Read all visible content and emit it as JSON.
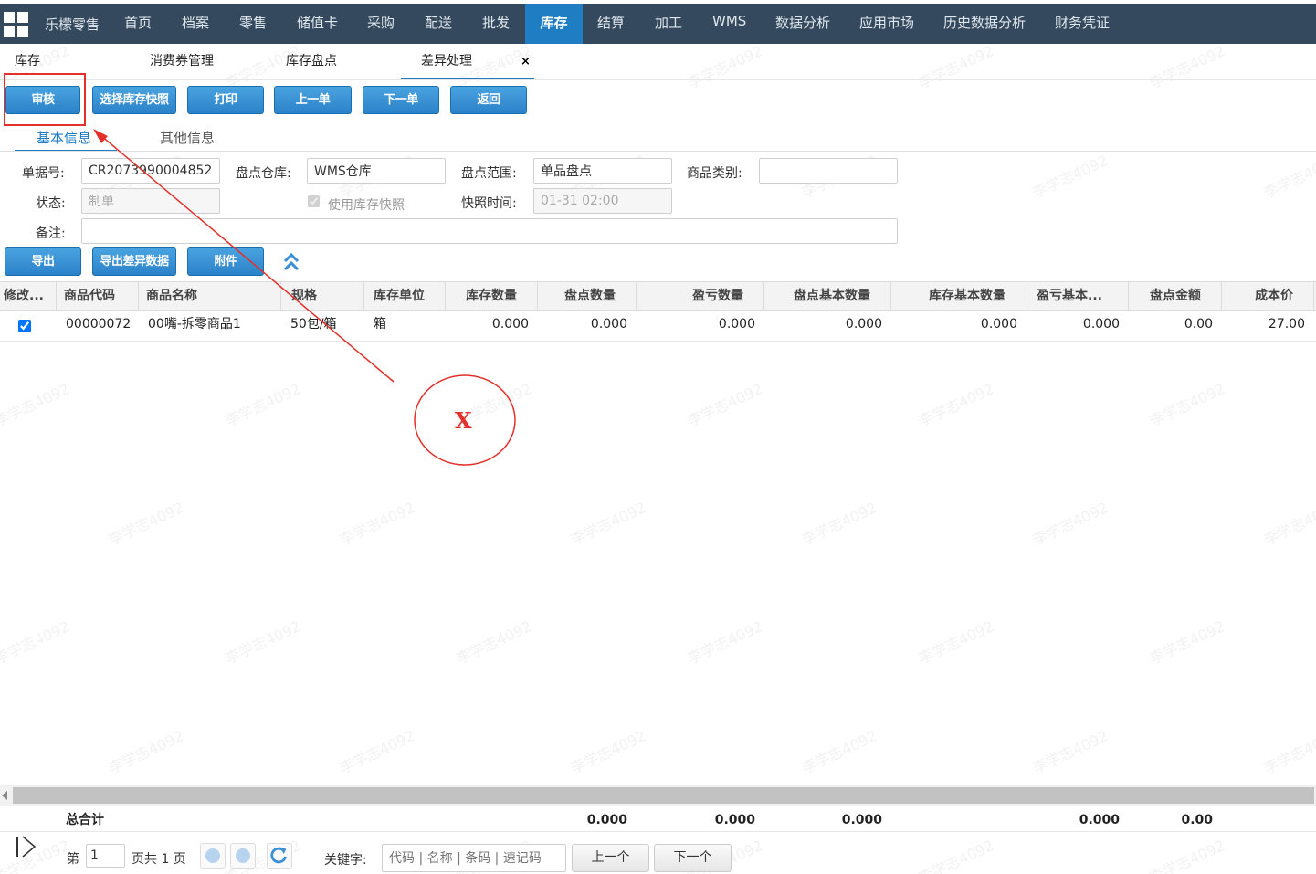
{
  "nav": {
    "brand": "乐檬零售",
    "items": [
      "首页",
      "档案",
      "零售",
      "储值卡",
      "采购",
      "配送",
      "批发",
      "库存",
      "结算",
      "加工",
      "WMS",
      "数据分析",
      "应用市场",
      "历史数据分析",
      "财务凭证"
    ],
    "active": "库存"
  },
  "tabs": [
    "库存",
    "消费券管理",
    "库存盘点",
    "差异处理"
  ],
  "tab_close": "×",
  "toolbar": [
    "审核",
    "选择库存快照",
    "打印",
    "上一单",
    "下一单",
    "返回"
  ],
  "subtabs": [
    "基本信息",
    "其他信息"
  ],
  "form": {
    "doc_no_label": "单据号:",
    "doc_no": "CR2073990004852",
    "warehouse_label": "盘点仓库:",
    "warehouse": "WMS仓库",
    "scope_label": "盘点范围:",
    "scope": "单品盘点",
    "category_label": "商品类别:",
    "category": "",
    "status_label": "状态:",
    "status": "制单",
    "use_snapshot_label": "使用库存快照",
    "snapshot_time_label": "快照时间:",
    "snapshot_time": "01-31 02:00",
    "remark_label": "备注:",
    "remark": ""
  },
  "actions": [
    "导出",
    "导出差异数据",
    "附件"
  ],
  "grid": {
    "columns": [
      "修改...",
      "商品代码",
      "商品名称",
      "规格",
      "库存单位",
      "库存数量",
      "盘点数量",
      "盈亏数量",
      "盘点基本数量",
      "库存基本数量",
      "盈亏基本...",
      "盘点金额",
      "成本价"
    ],
    "rows": [
      [
        "",
        "00000072",
        "00嘴-拆零商品1",
        "50包/箱",
        "箱",
        "0.000",
        "0.000",
        "0.000",
        "0.000",
        "0.000",
        "0.000",
        "0.00",
        "27.00"
      ]
    ]
  },
  "totals": {
    "label": "总合计",
    "count_qty": "0.000",
    "profit_qty": "0.000",
    "count_base_qty": "0.000",
    "profit_base_qty": "0.000",
    "count_amount": "0.00"
  },
  "pager": {
    "page_prefix": "第",
    "page": "1",
    "page_total": "页共 1 页",
    "keyword_label": "关键字:",
    "keyword_placeholder": "代码 | 名称 | 条码 | 速记码",
    "prev": "上一个",
    "next": "下一个"
  },
  "annotation": {
    "mark": "X",
    "color": "#e3302a"
  },
  "watermark": "李学志4092"
}
